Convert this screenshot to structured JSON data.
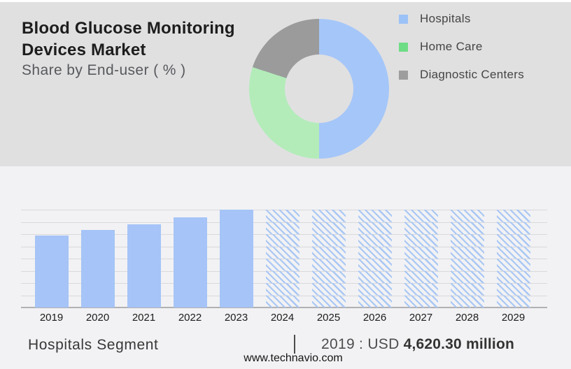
{
  "header": {
    "title": "Blood Glucose Monitoring Devices Market",
    "subtitle": "Share by End-user ( % )"
  },
  "legend": {
    "items": [
      {
        "label": "Hospitals",
        "color": "#9cc2f7"
      },
      {
        "label": "Home Care",
        "color": "#6fdc86"
      },
      {
        "label": "Diagnostic Centers",
        "color": "#9d9d9d"
      }
    ]
  },
  "footer": {
    "segment_label": "Hospitals Segment",
    "value_prefix": "2019 : USD",
    "value_bold": "4,620.30 million",
    "website": "www.technavio.com"
  },
  "chart_data": [
    {
      "type": "pie",
      "subtype": "donut",
      "title": "Share by End-user ( % )",
      "labels": [
        "Hospitals",
        "Home Care",
        "Diagnostic Centers"
      ],
      "values_pct": [
        50,
        30,
        20
      ],
      "slice_colors": [
        "#a5c6f8",
        "#b3ecb9",
        "#9b9b9c"
      ],
      "legend_position": "right",
      "start_angle_deg": 0,
      "direction": "clockwise"
    },
    {
      "type": "bar",
      "categories": [
        "2019",
        "2020",
        "2021",
        "2022",
        "2023",
        "2024",
        "2025",
        "2026",
        "2027",
        "2028",
        "2029"
      ],
      "values_usd_million": [
        4620.3,
        5000,
        5360,
        5790,
        6280,
        6280,
        6280,
        6280,
        6280,
        6280,
        6280
      ],
      "actual_years": [
        "2019",
        "2020",
        "2021",
        "2022",
        "2023"
      ],
      "forecast_years_hatched": [
        "2024",
        "2025",
        "2026",
        "2027",
        "2028",
        "2029"
      ],
      "labeled_point": {
        "year": "2019",
        "value_usd_million": 4620.3
      },
      "ylim": [
        0,
        6280
      ],
      "gridline_count": 8,
      "grid": true,
      "bar_color": "#a6c4f7",
      "hatch_color": "#a9c7f4",
      "note": "Only 2019 value labeled on image (USD 4,620.30 million); 2020-2023 estimated from bar heights; 2024-2029 are hatched forecast bars of uniform height equal to 2023."
    }
  ]
}
